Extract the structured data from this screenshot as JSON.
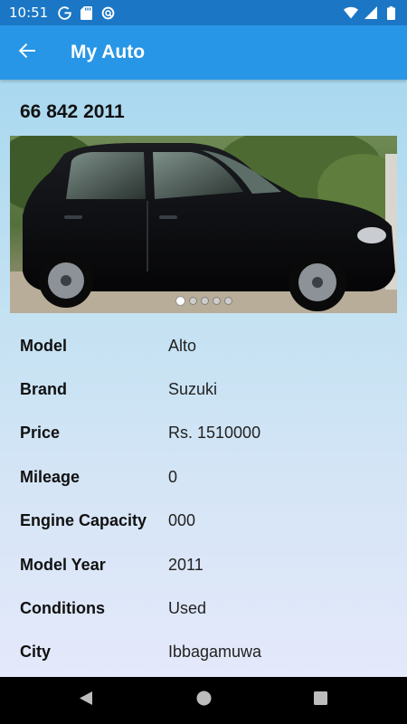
{
  "status_bar": {
    "time": "10:51",
    "left_icons": [
      "google-icon",
      "sd-card-icon",
      "sync-icon"
    ],
    "right_icons": [
      "wifi-icon",
      "signal-icon",
      "battery-icon"
    ]
  },
  "app_bar": {
    "back_icon": "arrow-back-icon",
    "title": "My Auto"
  },
  "vehicle": {
    "plate_number": "66 842 2011",
    "image_carousel": {
      "total_images": 5,
      "active_index": 0
    }
  },
  "details": [
    {
      "label": "Model",
      "value": "Alto"
    },
    {
      "label": "Brand",
      "value": "Suzuki"
    },
    {
      "label": "Price",
      "value": "Rs. 1510000"
    },
    {
      "label": "Mileage",
      "value": "0"
    },
    {
      "label": "Engine Capacity",
      "value": "000"
    },
    {
      "label": "Model Year",
      "value": "2011"
    },
    {
      "label": "Conditions",
      "value": "Used"
    },
    {
      "label": "City",
      "value": "Ibbagamuwa"
    }
  ],
  "nav_bar": {
    "buttons": [
      "back-triangle-icon",
      "home-circle-icon",
      "recents-square-icon"
    ]
  },
  "colors": {
    "status_bar": "#1b77c5",
    "app_bar": "#2896e6",
    "background_top": "#a9d8ef",
    "background_bottom": "#e4e9fb"
  }
}
